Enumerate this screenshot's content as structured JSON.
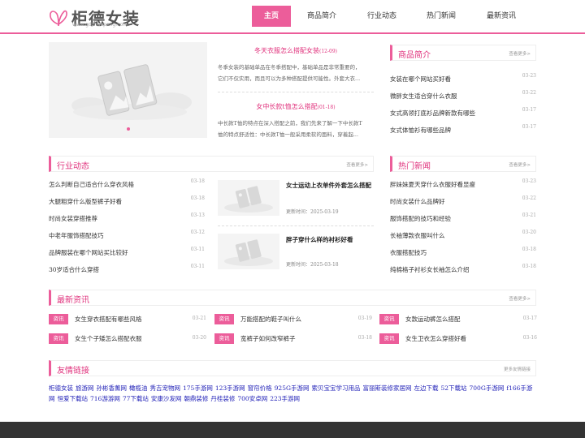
{
  "header": {
    "logo_name": "柜德女装",
    "logo_url": "www.gdzhuopeng.com",
    "accent": "#ec5d9a",
    "nav": [
      {
        "label": "主页",
        "active": true
      },
      {
        "label": "商品简介",
        "active": false
      },
      {
        "label": "行业动态",
        "active": false
      },
      {
        "label": "热门新闻",
        "active": false
      },
      {
        "label": "最新资讯",
        "active": false
      }
    ]
  },
  "slider": {
    "image_icon": "broken-image-icon",
    "slide_count": 1,
    "active_slide": 1
  },
  "features": [
    {
      "title": "冬天衣服怎么搭配女装",
      "date": "(12-09)",
      "desc": [
        "冬季女装的基础单品在冬季搭配中，基础单品是非常重要的，",
        "它们不仅实用，而且可以为多种搭配提供可能性。外套大衣..."
      ]
    },
    {
      "title": "女中长款t恤怎么搭配",
      "date": "(01-18)",
      "desc": [
        "中长款T恤的特点在深入搭配之前，我们先来了解一下中长款T",
        "恤的特点舒适性：中长款T恤一般采用柔软的面料，穿着起..."
      ]
    }
  ],
  "products": {
    "title": "商品简介",
    "more": "查看更多>",
    "items": [
      {
        "text": "女装在哪个网站买好看",
        "date": "03-23"
      },
      {
        "text": "微胖女生适合穿什么衣服",
        "date": "03-22"
      },
      {
        "text": "女式高领打底衫品牌新款有哪些",
        "date": "03-17"
      },
      {
        "text": "女式体恤衫有哪些品牌",
        "date": "03-17"
      }
    ]
  },
  "industry": {
    "title": "行业动态",
    "more": "查看更多>",
    "items": [
      {
        "text": "怎么判断自己适合什么穿衣风格",
        "date": "03-18"
      },
      {
        "text": "大腿粗穿什么版型裤子好看",
        "date": "03-18"
      },
      {
        "text": "时尚女装穿搭推荐",
        "date": "03-13"
      },
      {
        "text": "中老年服饰搭配技巧",
        "date": "03-12"
      },
      {
        "text": "品牌服装在哪个网站买比较好",
        "date": "03-11"
      },
      {
        "text": "30岁适合什么穿搭",
        "date": "03-11"
      }
    ],
    "thumbs": [
      {
        "title": "女士运动上衣单件外套怎么搭配",
        "date": "更新时间：2025-03-19"
      },
      {
        "title": "胖子穿什么样的衬衫好看",
        "date": "更新时间：2025-03-18"
      }
    ]
  },
  "hot": {
    "title": "热门新闻",
    "more": "查看更多>",
    "items": [
      {
        "text": "胖妹妹夏天穿什么衣服好看显瘦",
        "date": "03-23"
      },
      {
        "text": "时尚女装什么品牌好",
        "date": "03-22"
      },
      {
        "text": "服饰搭配的技巧和经验",
        "date": "03-21"
      },
      {
        "text": "长袖薄款衣服叫什么",
        "date": "03-20"
      },
      {
        "text": "衣服搭配技巧",
        "date": "03-18"
      },
      {
        "text": "纯棉格子衬衫女长袖怎么介绍",
        "date": "03-18"
      }
    ]
  },
  "latest": {
    "title": "最新资讯",
    "more": "查看更多>",
    "tag": "资讯",
    "items": [
      {
        "text": "女生穿衣搭配有哪些风格",
        "date": "03-21"
      },
      {
        "text": "万能搭配的鞋子叫什么",
        "date": "03-19"
      },
      {
        "text": "女款运动裤怎么搭配",
        "date": "03-17"
      },
      {
        "text": "女生个子矮怎么搭配衣服",
        "date": "03-20"
      },
      {
        "text": "宽裤子如何改窄裤子",
        "date": "03-18"
      },
      {
        "text": "女生卫衣怎么穿搭好看",
        "date": "03-16"
      }
    ]
  },
  "friends": {
    "title": "友情链接",
    "more": "更多友情链接",
    "links": [
      "柜德女装",
      "旅游网",
      "孙彬香薰网",
      "橄榄油",
      "秀吉宠物网",
      "175手游网",
      "123手游网",
      "窗帘价格",
      "925G手游网",
      "索贝宝宝学习用品",
      "富丽斯装修家居网",
      "左边下载",
      "52下载站",
      "700G手游网",
      "f166手游网",
      "恒爱下载站",
      "716游游网",
      "77下载站",
      "安康沙发网",
      "朝鼎装修",
      "丹桂装修",
      "700安卓网",
      "223手游网"
    ]
  }
}
